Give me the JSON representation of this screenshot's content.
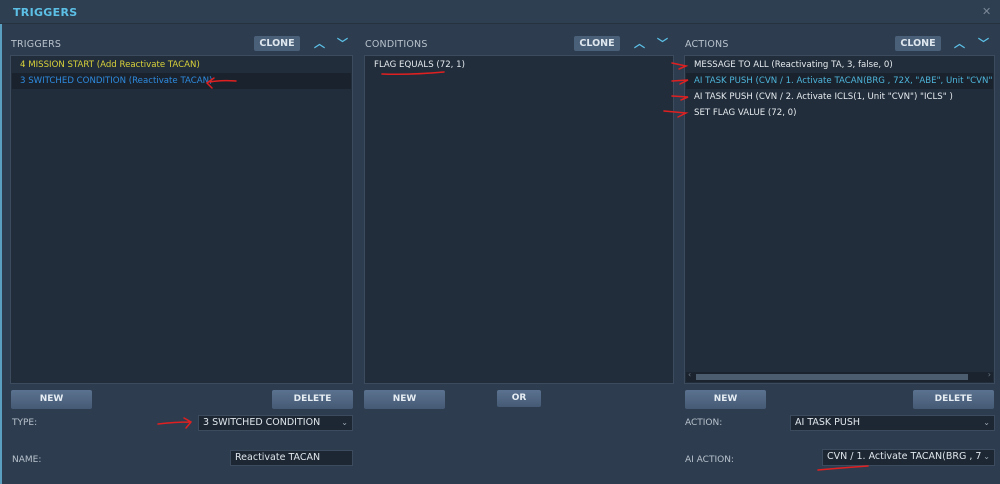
{
  "window": {
    "title": "TRIGGERS",
    "close_icon": "close-icon"
  },
  "triggers": {
    "header": "TRIGGERS",
    "clone_label": "CLONE",
    "items": [
      {
        "label": "4 MISSION START (Add Reactivate TACAN)",
        "color": "#d9d23a"
      },
      {
        "label": "3 SWITCHED CONDITION (Reactivate TACAN)",
        "color": "#2f8be0",
        "selected": true
      }
    ],
    "new_label": "NEW",
    "delete_label": "DELETE",
    "type_label": "TYPE:",
    "type_value": "3 SWITCHED CONDITION",
    "name_label": "NAME:",
    "name_value": "Reactivate TACAN"
  },
  "conditions": {
    "header": "CONDITIONS",
    "clone_label": "CLONE",
    "items": [
      {
        "label": "FLAG EQUALS (72, 1)"
      }
    ],
    "new_label": "NEW",
    "or_label": "OR"
  },
  "actions": {
    "header": "ACTIONS",
    "clone_label": "CLONE",
    "items": [
      {
        "label": "MESSAGE TO ALL (Reactivating TA, 3, false, 0)",
        "color": "#e6ebef"
      },
      {
        "label": "AI TASK PUSH (CVN / 1. Activate TACAN(BRG , 72X, \"ABE\", Unit \"CVN\")  \"AI",
        "color": "#4fb6dc",
        "selected": true
      },
      {
        "label": "AI TASK PUSH (CVN / 2. Activate ICLS(1, Unit \"CVN\")  \"ICLS\" )",
        "color": "#e6ebef"
      },
      {
        "label": "SET FLAG VALUE (72, 0)",
        "color": "#e6ebef"
      }
    ],
    "new_label": "NEW",
    "delete_label": "DELETE",
    "action_label": "ACTION:",
    "action_value": "AI TASK PUSH",
    "ai_action_label": "AI ACTION:",
    "ai_action_value": "CVN / 1. Activate TACAN(BRG , 7"
  },
  "colors": {
    "accent": "#5cc0e6",
    "annotation": "#e02020"
  }
}
